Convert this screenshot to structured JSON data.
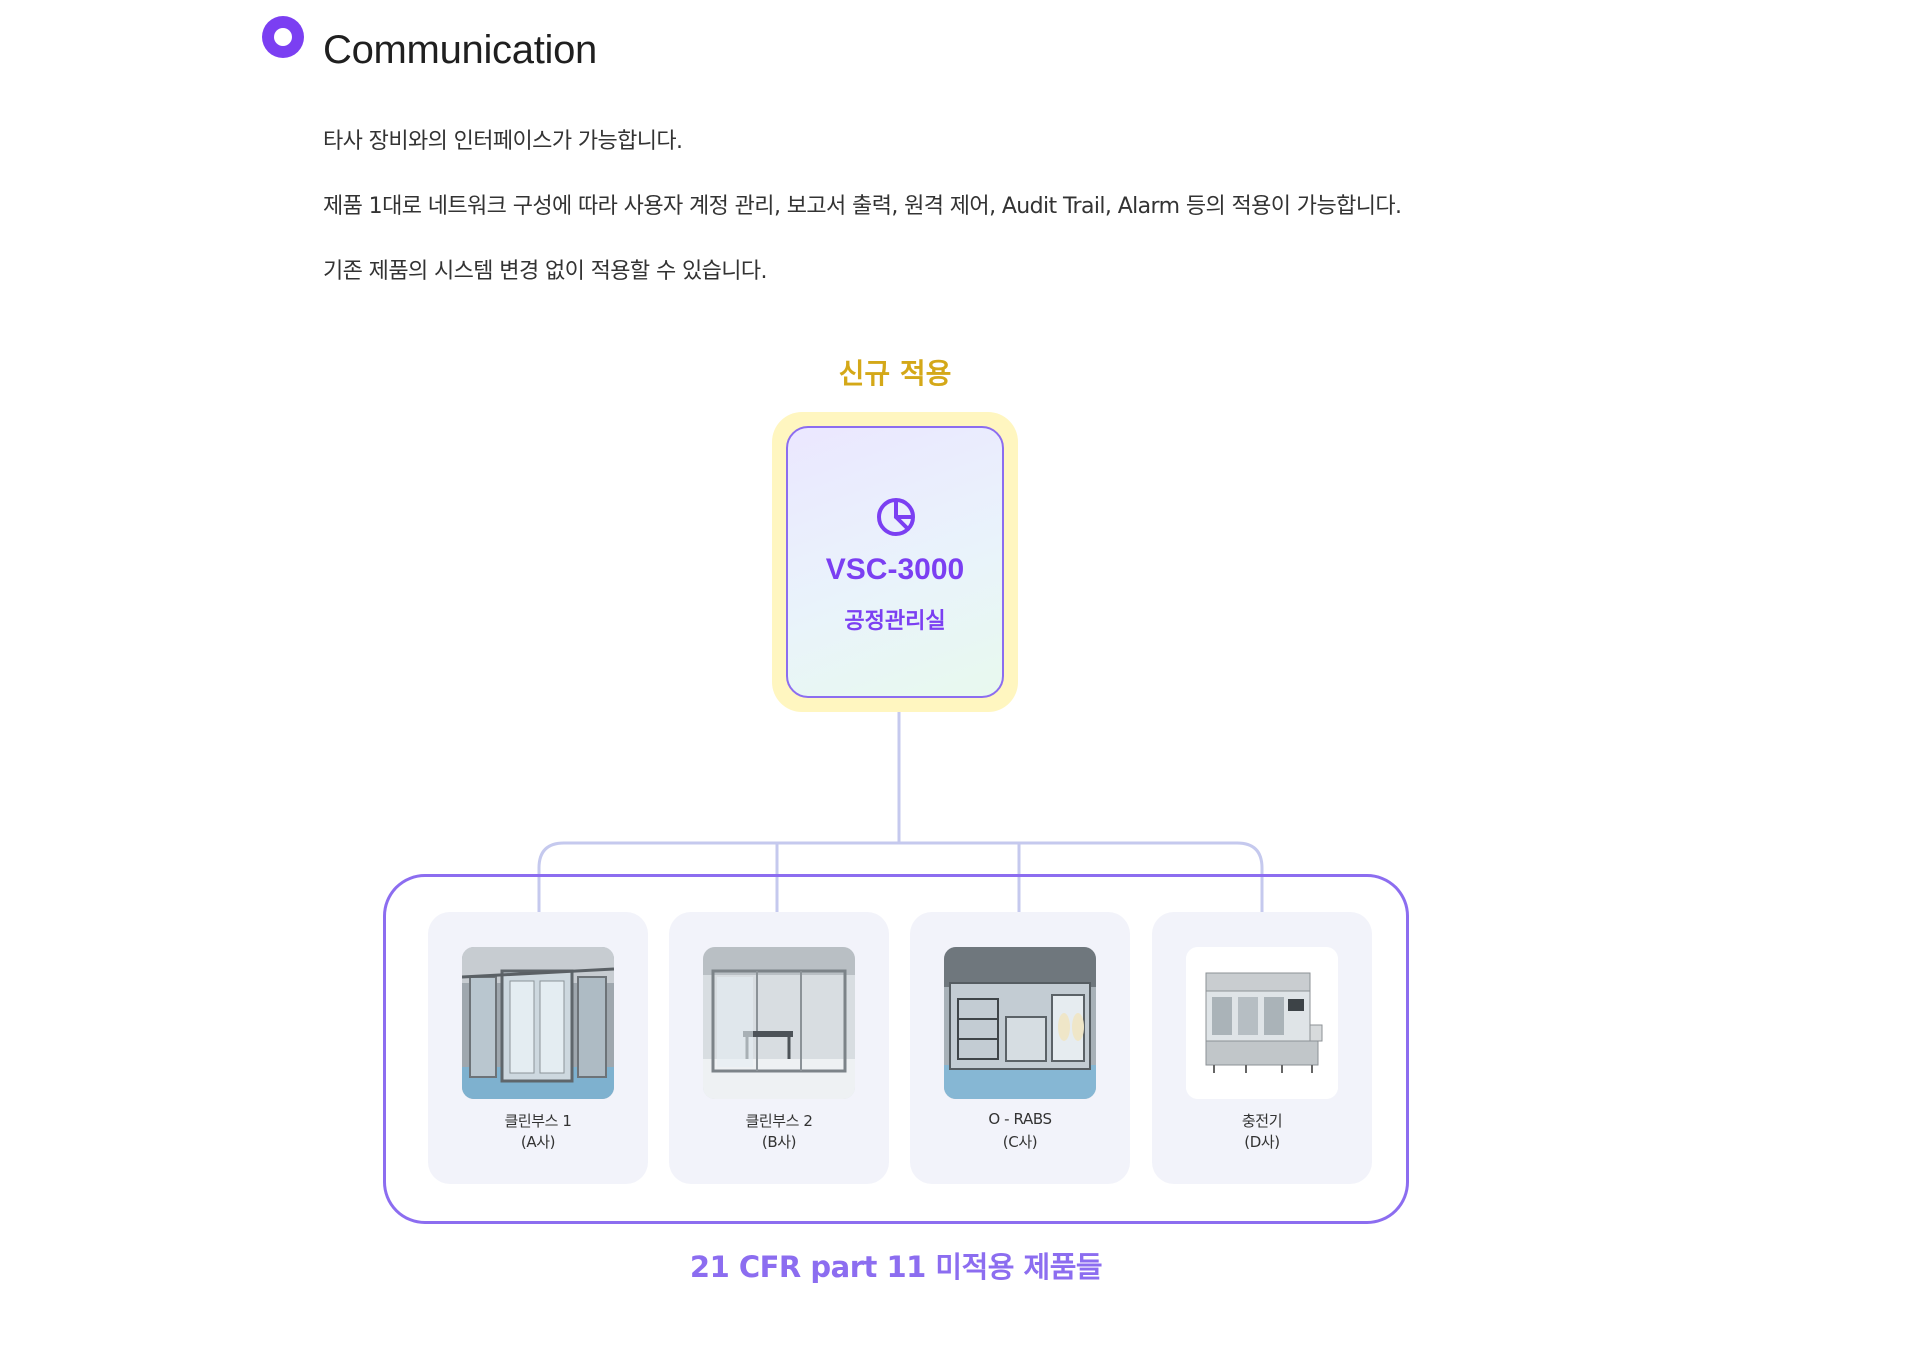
{
  "section": {
    "title": "Communication",
    "paragraphs": [
      "타사 장비와의 인터페이스가 가능합니다.",
      "제품 1대로 네트워크 구성에 따라 사용자 계정 관리, 보고서 출력, 원격 제어, Audit Trail, Alarm 등의 적용이 가능합니다.",
      "기존 제품의 시스템 변경 없이 적용할 수 있습니다."
    ]
  },
  "diagram": {
    "new_label": "신규 적용",
    "main": {
      "model": "VSC-3000",
      "subtitle": "공정관리실",
      "icon": "pie-chart-icon"
    },
    "devices": [
      {
        "name": "클린부스 1",
        "vendor": "(A사)"
      },
      {
        "name": "클린부스 2",
        "vendor": "(B사)"
      },
      {
        "name": "O - RABS",
        "vendor": "(C사)"
      },
      {
        "name": "충전기",
        "vendor": "(D사)"
      }
    ],
    "footer_label": "21 CFR part 11 미적용 제품들",
    "colors": {
      "accent": "#7b3ff2",
      "frame": "#8c6df0",
      "highlight": "#d4a818",
      "connector": "#c5c9ee"
    }
  }
}
